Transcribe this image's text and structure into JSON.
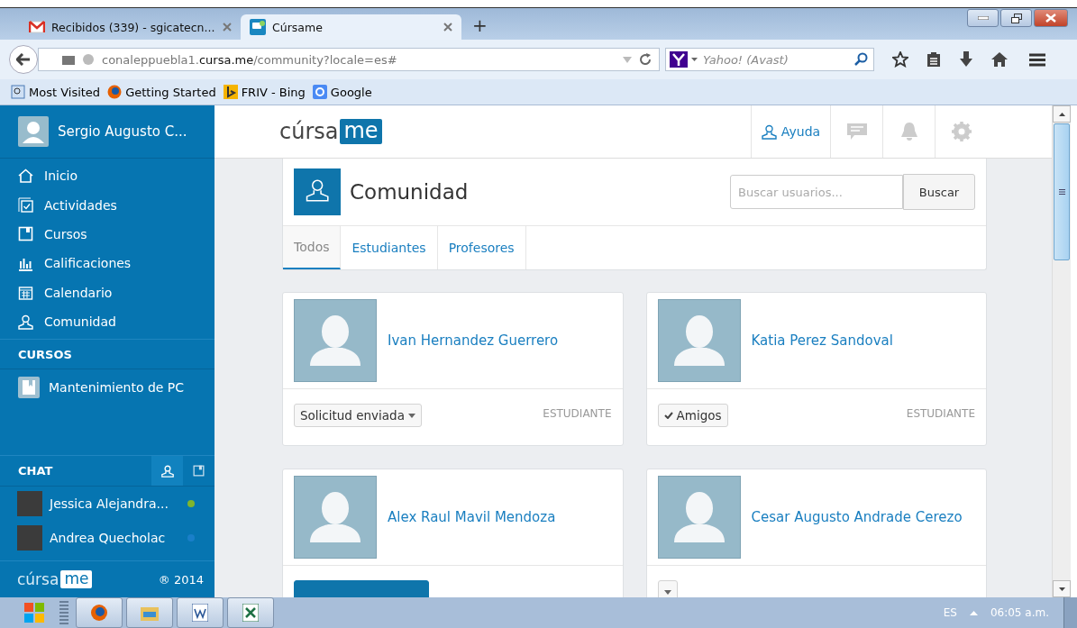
{
  "browser": {
    "tabs": [
      {
        "label": "Recibidos (339) - sgicatecn...",
        "selected": false
      },
      {
        "label": "Cúrsame",
        "selected": true
      }
    ],
    "new_tab": "+",
    "address": {
      "prefix": "conaleppuebla1.",
      "domain": "cursa.me",
      "path": "/community?locale=es#"
    },
    "search": {
      "placeholder": "Yahoo! (Avast)"
    },
    "bookmarks": [
      "Most Visited",
      "Getting Started",
      "FRIV - Bing",
      "Google"
    ]
  },
  "sidebar": {
    "user": "Sergio Augusto C...",
    "nav": [
      "Inicio",
      "Actividades",
      "Cursos",
      "Calificaciones",
      "Calendario",
      "Comunidad"
    ],
    "courses_heading": "CURSOS",
    "courses": [
      "Mantenimiento de PC"
    ],
    "chat_heading": "CHAT",
    "chat": [
      {
        "name": "Jessica Alejandra...",
        "color": "#7fb52d"
      },
      {
        "name": "Andrea Quecholac",
        "color": "#1a7fc9"
      }
    ],
    "logo": {
      "word": "cúrsa",
      "badge": "me"
    },
    "copyright": "® 2014"
  },
  "topbar": {
    "logo": {
      "word": "cúrsa",
      "badge": "me"
    },
    "help": "Ayuda"
  },
  "community": {
    "title": "Comunidad",
    "search": {
      "placeholder": "Buscar usuarios..."
    },
    "search_button": "Buscar",
    "tabs": [
      {
        "label": "Todos",
        "selected": true
      },
      {
        "label": "Estudiantes",
        "selected": false
      },
      {
        "label": "Profesores",
        "selected": false
      }
    ]
  },
  "people": [
    {
      "name": "Ivan Hernandez Guerrero",
      "action": {
        "kind": "dropdown",
        "label": "Solicitud enviada"
      },
      "role": "ESTUDIANTE"
    },
    {
      "name": "Katia Perez Sandoval",
      "action": {
        "kind": "friends",
        "label": "Amigos"
      },
      "role": "ESTUDIANTE"
    },
    {
      "name": "Alex Raul Mavil Mendoza",
      "action": {
        "kind": "primary"
      }
    },
    {
      "name": "Cesar Augusto Andrade Cerezo",
      "action": {
        "kind": "dropdown"
      }
    }
  ],
  "taskbar": {
    "language": "ES",
    "clock": "06:05 a.m."
  }
}
